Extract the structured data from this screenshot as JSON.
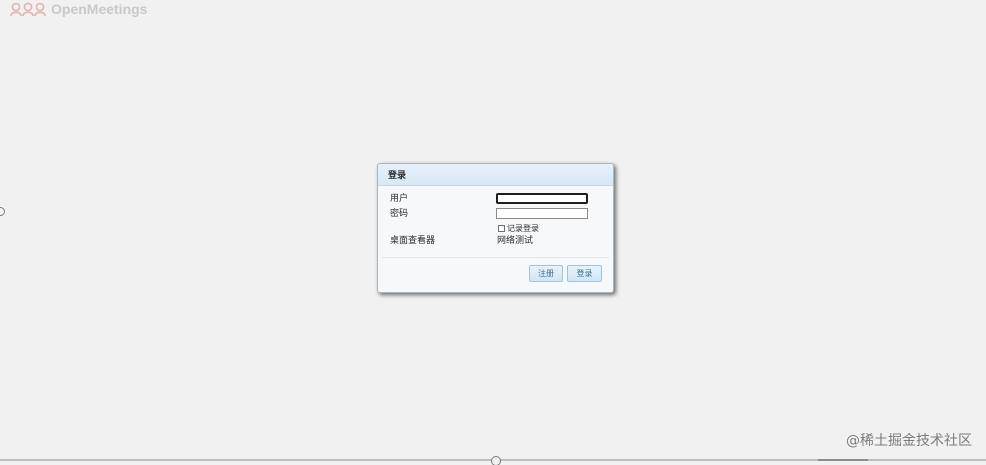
{
  "brand": {
    "name": "OpenMeetings",
    "logo_icon": "people-group-icon"
  },
  "login_dialog": {
    "title": "登录",
    "username": {
      "label": "用户",
      "value": ""
    },
    "password": {
      "label": "密码",
      "value": ""
    },
    "remember_me": {
      "label": "记录登录",
      "checked": false
    },
    "desktop_viewer_link": "桌面查看器",
    "network_test_link": "网络测试",
    "register_button": "注册",
    "login_button": "登录"
  },
  "watermark": "@稀土掘金技术社区",
  "colors": {
    "background": "#f1f1f1",
    "dialog_header": "#dfeaf6",
    "button_text": "#3a6f96",
    "logo": "#c9c9c9"
  }
}
